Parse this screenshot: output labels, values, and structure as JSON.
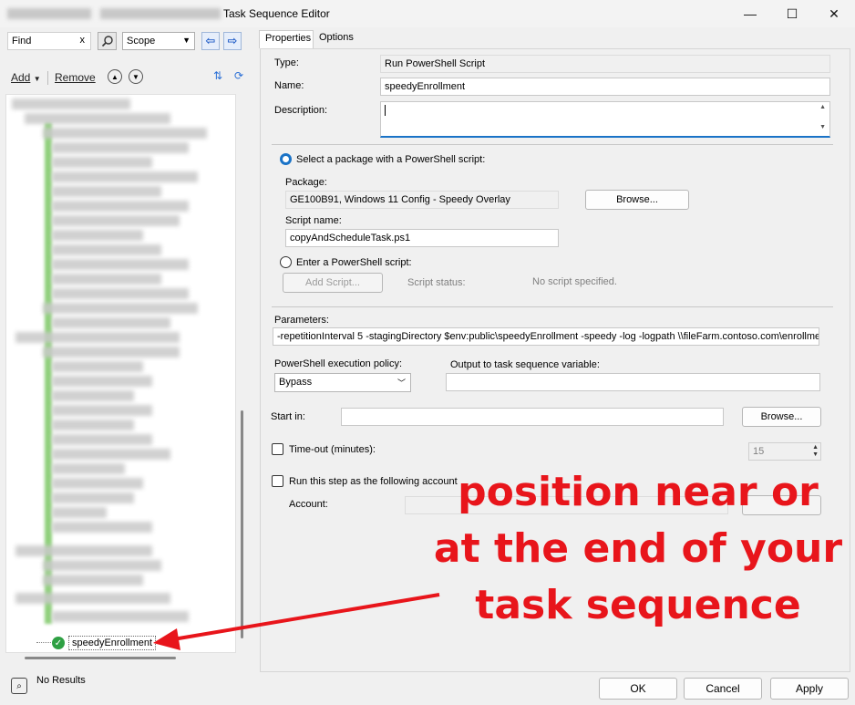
{
  "window": {
    "title": "Task Sequence Editor",
    "minimize": "—",
    "maximize": "☐",
    "close": "✕"
  },
  "left": {
    "find_value": "Find",
    "find_clear": "x",
    "scope_value": "Scope",
    "add_label": "Add",
    "remove_label": "Remove",
    "tree_selected_item": "speedyEnrollment",
    "status": "No Results"
  },
  "tabs": [
    "Properties",
    "Options"
  ],
  "props": {
    "type_label": "Type:",
    "type_value": "Run PowerShell Script",
    "name_label": "Name:",
    "name_value": "speedyEnrollment",
    "description_label": "Description:",
    "description_value": "",
    "select_package_radio": "Select a package with a PowerShell script:",
    "package_label": "Package:",
    "package_value": "GE100B91, Windows 11 Config - Speedy Overlay",
    "browse_label": "Browse...",
    "script_name_label": "Script name:",
    "script_name_value": "copyAndScheduleTask.ps1",
    "enter_script_radio": "Enter a PowerShell script:",
    "add_script_label": "Add Script...",
    "script_status_label": "Script status:",
    "script_status_value": "No script specified.",
    "parameters_label": "Parameters:",
    "parameters_value": "-repetitionInterval 5 -stagingDirectory $env:public\\speedyEnrollment -speedy -log -logpath \\\\fileFarm.contoso.com\\enrollmentLo",
    "policy_label": "PowerShell execution policy:",
    "policy_value": "Bypass",
    "output_label": "Output to task sequence variable:",
    "output_value": "",
    "start_in_label": "Start in:",
    "start_in_value": "",
    "start_in_browse": "Browse...",
    "timeout_label": "Time-out (minutes):",
    "timeout_value": "15",
    "runas_label": "Run this step as the following account",
    "account_label": "Account:"
  },
  "buttons": {
    "ok": "OK",
    "cancel": "Cancel",
    "apply": "Apply"
  },
  "annotation": {
    "line1": "position near or",
    "line2": "at the end of your",
    "line3": "task sequence",
    "color": "#e8151b"
  }
}
